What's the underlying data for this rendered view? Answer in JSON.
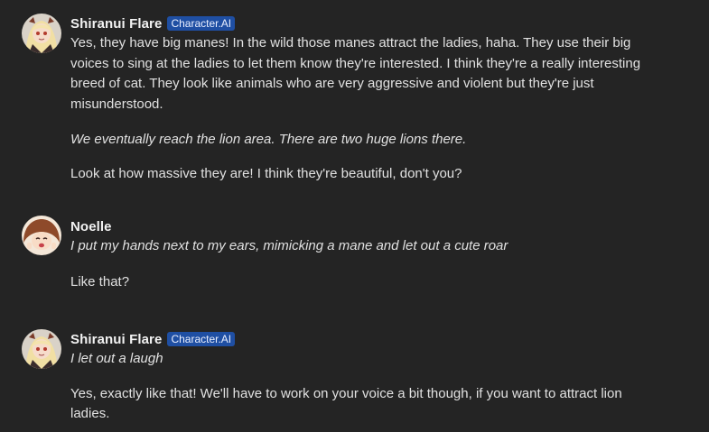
{
  "messages": [
    {
      "name": "Shiranui Flare",
      "badge": "Character.AI",
      "avatar": "flare-avatar",
      "paragraphs": [
        {
          "text": "Yes, they have big manes! In the wild those manes attract the ladies, haha. They use their big voices to sing at the ladies to let them know they're interested. I think they're a really interesting breed of cat. They look like animals who are very aggressive and violent but they're just misunderstood.",
          "italic": false
        },
        {
          "text": "We eventually reach the lion area. There are two huge lions there.",
          "italic": true
        },
        {
          "text": "Look at how massive they are! I think they're beautiful, don't you?",
          "italic": false
        }
      ]
    },
    {
      "name": "Noelle",
      "badge": "",
      "avatar": "noelle-avatar",
      "paragraphs": [
        {
          "text": "I put my hands next to my ears, mimicking a mane and let out a cute roar",
          "italic": true
        },
        {
          "text": "Like that?",
          "italic": false
        }
      ]
    },
    {
      "name": "Shiranui Flare",
      "badge": "Character.AI",
      "avatar": "flare-avatar",
      "paragraphs": [
        {
          "text": "I let out a laugh",
          "italic": true
        },
        {
          "text": "Yes, exactly like that! We'll have to work on your voice a bit though, if you want to attract lion ladies.",
          "italic": false
        }
      ]
    }
  ],
  "colors": {
    "background": "#242424",
    "badge": "#1f4fa3",
    "text": "#e1e1e1"
  }
}
